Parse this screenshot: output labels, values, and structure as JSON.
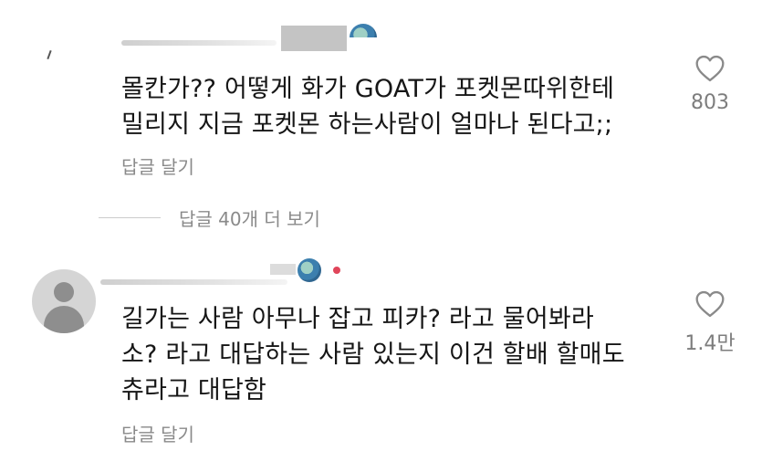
{
  "comments": [
    {
      "text": "몰칸가?? 어떻게 화가 GOAT가 포켓몬따위한테\n밀리지 지금 포켓몬 하는사람이 얼마나 된다고;;",
      "reply_label": "답글 달기",
      "likes": "803"
    },
    {
      "text": "길가는 사람 아무나 잡고 피카? 라고 물어봐라\n소? 라고 대답하는 사람 있는지 이건 할배 할매도\n츄라고 대답함",
      "reply_label": "답글 달기",
      "likes": "1.4만"
    }
  ],
  "view_replies_label": "답글 40개 더 보기",
  "icons": {
    "like": "heart-outline-icon",
    "avatar": "default-user-avatar-icon"
  },
  "colors": {
    "text": "#161616",
    "muted": "#8a8a8a",
    "like_count": "#7d7d7d",
    "avatar_bg": "#d5d5d5",
    "avatar_fg": "#8e8e8e"
  }
}
